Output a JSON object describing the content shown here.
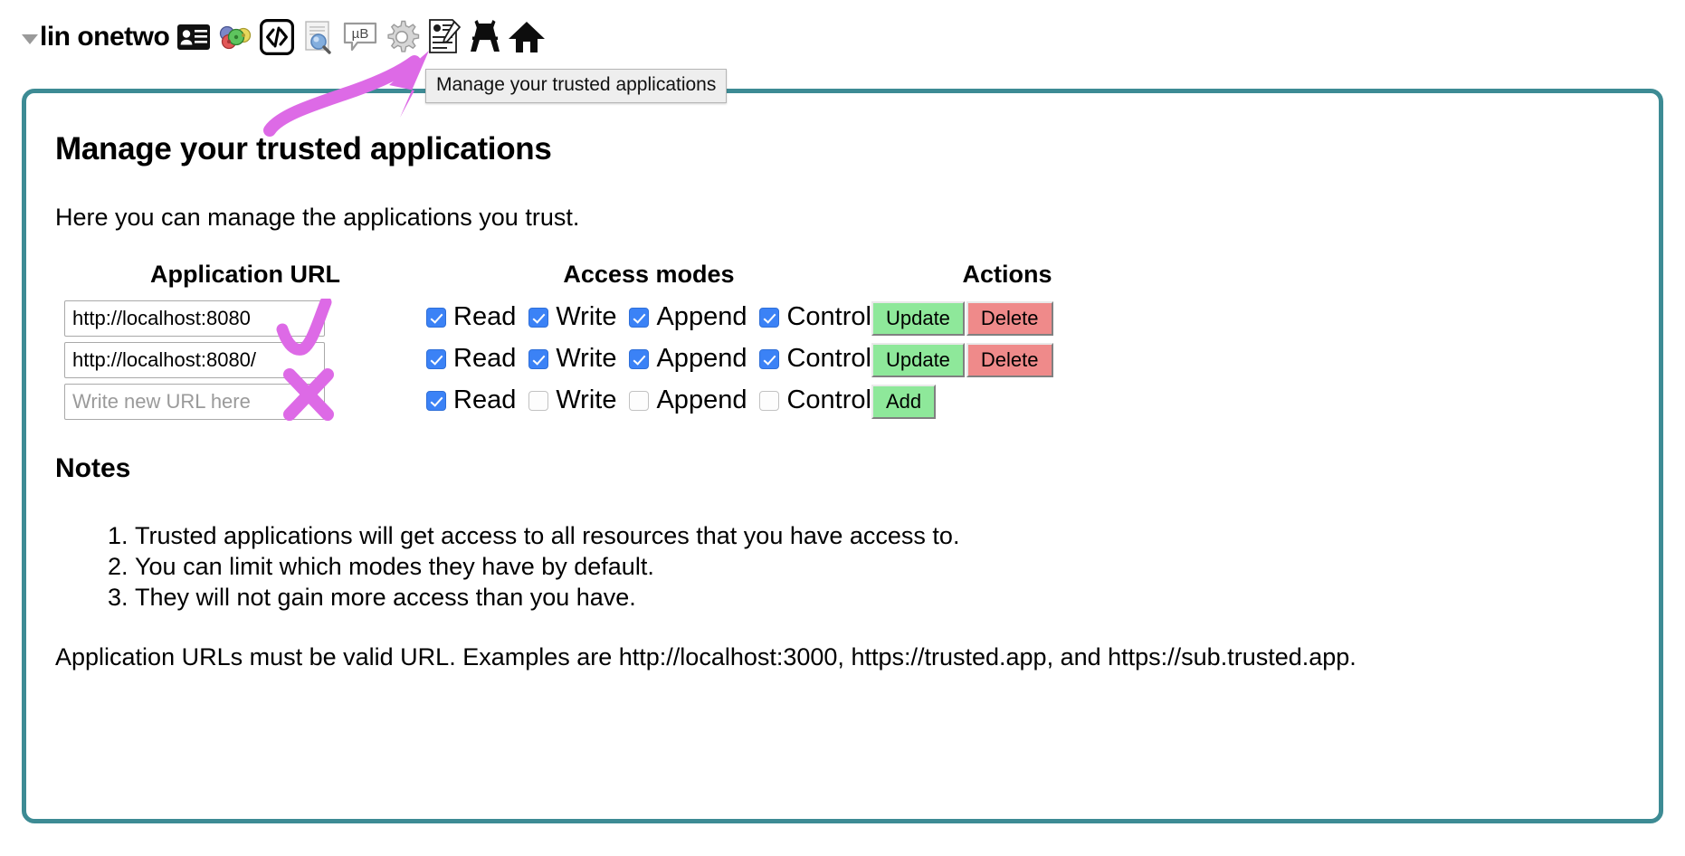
{
  "topbar": {
    "disclosure": "collapse-triangle",
    "user_name": "lin onetwo",
    "icons": [
      {
        "name": "contact-card-icon",
        "label": "Contact card"
      },
      {
        "name": "color-palette-icon",
        "label": "Colors"
      },
      {
        "name": "code-icon",
        "label": "Code"
      },
      {
        "name": "document-search-icon",
        "label": "Search document"
      },
      {
        "name": "mb-chat-icon",
        "label": "μB"
      },
      {
        "name": "gear-icon",
        "label": "Settings"
      },
      {
        "name": "edit-profile-icon",
        "label": "Edit profile"
      },
      {
        "name": "trusted-apps-icon",
        "label": "Manage your trusted applications"
      },
      {
        "name": "home-icon",
        "label": "Home"
      }
    ]
  },
  "tooltip": {
    "text": "Manage your trusted applications"
  },
  "annotations": {
    "arrow_color": "#dd6ae6",
    "check_mark": "valid-url-check",
    "cross_mark": "invalid-url-cross"
  },
  "panel": {
    "border_color": "#3d8b94",
    "title": "Manage your trusted applications",
    "intro": "Here you can manage the applications you trust."
  },
  "table": {
    "headers": {
      "url": "Application URL",
      "modes": "Access modes",
      "actions": "Actions"
    },
    "mode_labels": [
      "Read",
      "Write",
      "Append",
      "Control"
    ],
    "rows": [
      {
        "url_value": "http://localhost:8080",
        "url_placeholder": "",
        "modes": [
          true,
          true,
          true,
          true
        ],
        "actions": [
          {
            "label": "Update",
            "kind": "update"
          },
          {
            "label": "Delete",
            "kind": "delete"
          }
        ]
      },
      {
        "url_value": "http://localhost:8080/",
        "url_placeholder": "",
        "modes": [
          true,
          true,
          true,
          true
        ],
        "actions": [
          {
            "label": "Update",
            "kind": "update"
          },
          {
            "label": "Delete",
            "kind": "delete"
          }
        ]
      },
      {
        "url_value": "",
        "url_placeholder": "Write new URL here",
        "modes": [
          true,
          false,
          false,
          false
        ],
        "actions": [
          {
            "label": "Add",
            "kind": "add"
          }
        ]
      }
    ]
  },
  "notes": {
    "title": "Notes",
    "items": [
      "Trusted applications will get access to all resources that you have access to.",
      "You can limit which modes they have by default.",
      "They will not gain more access than you have."
    ],
    "footnote": "Application URLs must be valid URL. Examples are http://localhost:3000, https://trusted.app, and https://sub.trusted.app."
  },
  "colors": {
    "accent_teal": "#3d8b94",
    "checkbox_blue": "#3b82f6",
    "button_green": "#8ee89a",
    "button_red": "#ef8a8a",
    "marker_purple": "#dd6ae6"
  }
}
